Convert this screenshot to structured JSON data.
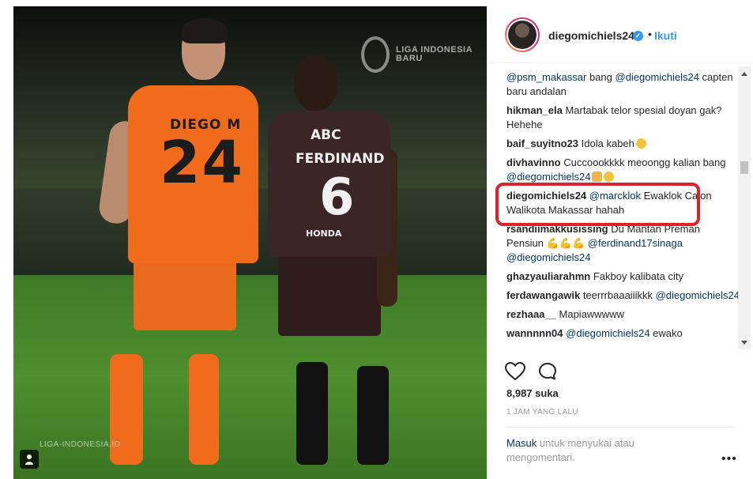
{
  "post": {
    "image": {
      "watermark_top": "LIGA INDONESIA BARU",
      "watermark_bottom": "LIGA-INDONESIA.ID",
      "player1": {
        "name": "DIEGO M",
        "number": "24"
      },
      "player2": {
        "sponsor": "ABC",
        "name": "FERDINAND",
        "number": "6",
        "brand": "HONDA"
      }
    },
    "header": {
      "username": "diegomichiels24",
      "separator": "•",
      "follow_label": "Ikuti"
    },
    "comments": [
      {
        "user": "",
        "parts": [
          {
            "t": "@psm_makassar",
            "m": true
          },
          {
            "t": " bang ",
            "m": false
          },
          {
            "t": "@diegomichiels24",
            "m": true
          },
          {
            "t": " capten baru andalan",
            "m": false
          }
        ]
      },
      {
        "user": "hikman_ela",
        "parts": [
          {
            "t": "Martabak telor spesial doyan gak? Hehehe",
            "m": false
          }
        ]
      },
      {
        "user": "baif_suyitno23",
        "parts": [
          {
            "t": "Idola kabeh",
            "m": false
          }
        ],
        "emoji": [
          "face"
        ]
      },
      {
        "user": "divhavinno",
        "parts": [
          {
            "t": "Cuccoookkkk meoongg kalian bang ",
            "m": false
          },
          {
            "t": "@diegomichiels24",
            "m": true
          }
        ],
        "emoji": [
          "hand",
          "face"
        ]
      },
      {
        "user": "diegomichiels24",
        "parts": [
          {
            "t": "@marcklok",
            "m": true
          },
          {
            "t": " Ewaklok Calon Walikota Makassar hahah",
            "m": false
          }
        ]
      },
      {
        "user": "rsandiimakkusissing",
        "parts": [
          {
            "t": "Du Mantan Preman Pensiun ",
            "m": false
          },
          {
            "t": "💪💪💪",
            "m": false,
            "e": true
          },
          {
            "t": " @ferdinand17sinaga",
            "m": true
          },
          {
            "t": " @diegomichiels24",
            "m": true
          }
        ]
      },
      {
        "user": "ghazyauliarahmn",
        "parts": [
          {
            "t": "Fakboy kalibata city",
            "m": false
          }
        ]
      },
      {
        "user": "ferdawangawik",
        "parts": [
          {
            "t": "teerrrbaaaiiikkk ",
            "m": false
          },
          {
            "t": "@diegomichiels24",
            "m": true
          }
        ]
      },
      {
        "user": "rezhaaa__",
        "parts": [
          {
            "t": "Mapiawwwww",
            "m": false
          }
        ]
      },
      {
        "user": "wannnnn04",
        "parts": [
          {
            "t": " @diegomichiels24",
            "m": true
          },
          {
            "t": " ewako",
            "m": false
          }
        ]
      }
    ],
    "likes": "8,987 suka",
    "time": "1 JAM YANG LALU",
    "login": {
      "link": "Masuk",
      "text": " untuk menyukai atau mengomentari."
    },
    "more_label": "•••",
    "colors": {
      "link": "#003569",
      "accent": "#3897f0",
      "highlight": "#e0202a"
    },
    "icons": [
      "heart-icon",
      "comment-icon",
      "verified-icon",
      "more-options-icon",
      "user-tag-icon"
    ]
  }
}
